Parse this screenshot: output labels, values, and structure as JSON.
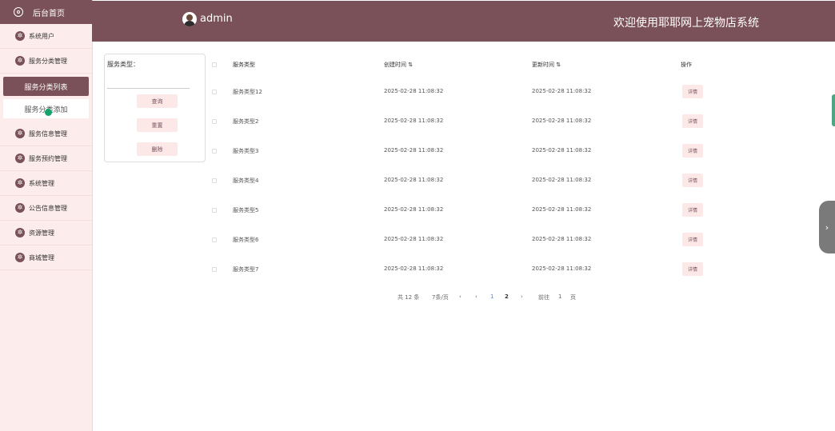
{
  "sidebar": {
    "home_label": "后台首页",
    "items": [
      {
        "label": "系统用户"
      },
      {
        "label": "服务分类管理"
      },
      {
        "label": "服务信息管理"
      },
      {
        "label": "服务预约管理"
      },
      {
        "label": "系统管理"
      },
      {
        "label": "公告信息管理"
      },
      {
        "label": "资源管理"
      },
      {
        "label": "商城管理"
      }
    ],
    "sub_items": [
      {
        "label": "服务分类列表",
        "active": true
      },
      {
        "label": "服务分类添加",
        "active": false
      }
    ]
  },
  "header": {
    "username": "admin",
    "site_title": "欢迎使用耶耶网上宠物店系统"
  },
  "search": {
    "label": "服务类型：",
    "input_value": "",
    "query_button": "查询",
    "reset_button": "重置",
    "delete_button": "删除"
  },
  "table": {
    "columns": {
      "type": "服务类型",
      "created": "创建时间",
      "updated": "更新时间",
      "action": "操作"
    },
    "rows": [
      {
        "type": "服务类型12",
        "created": "2025-02-28 11:08:32",
        "updated": "2025-02-28 11:08:32",
        "action": "详情"
      },
      {
        "type": "服务类型2",
        "created": "2025-02-28 11:08:32",
        "updated": "2025-02-28 11:08:32",
        "action": "详情"
      },
      {
        "type": "服务类型3",
        "created": "2025-02-28 11:08:32",
        "updated": "2025-02-28 11:08:32",
        "action": "详情"
      },
      {
        "type": "服务类型4",
        "created": "2025-02-28 11:08:32",
        "updated": "2025-02-28 11:08:32",
        "action": "详情"
      },
      {
        "type": "服务类型5",
        "created": "2025-02-28 11:08:32",
        "updated": "2025-02-28 11:08:32",
        "action": "详情"
      },
      {
        "type": "服务类型6",
        "created": "2025-02-28 11:08:32",
        "updated": "2025-02-28 11:08:32",
        "action": "详情"
      },
      {
        "type": "服务类型7",
        "created": "2025-02-28 11:08:32",
        "updated": "2025-02-28 11:08:32",
        "action": "详情"
      }
    ]
  },
  "pagination": {
    "total_text": "共 12 条",
    "page_size_text": "7条/页",
    "prev": "‹",
    "prev_more": "‹",
    "page1": "1",
    "page2": "2",
    "next": "›",
    "goto_label": "前往",
    "goto_value": "1",
    "page_suffix": "页"
  },
  "side_handle": {
    "icon": "chevron-right-icon",
    "glyph": "›"
  },
  "colors": {
    "accent": "#7a5158",
    "sidebar_bg": "#fdecec",
    "button_bg": "#fde8e8",
    "active_page": "#3c8af0"
  }
}
